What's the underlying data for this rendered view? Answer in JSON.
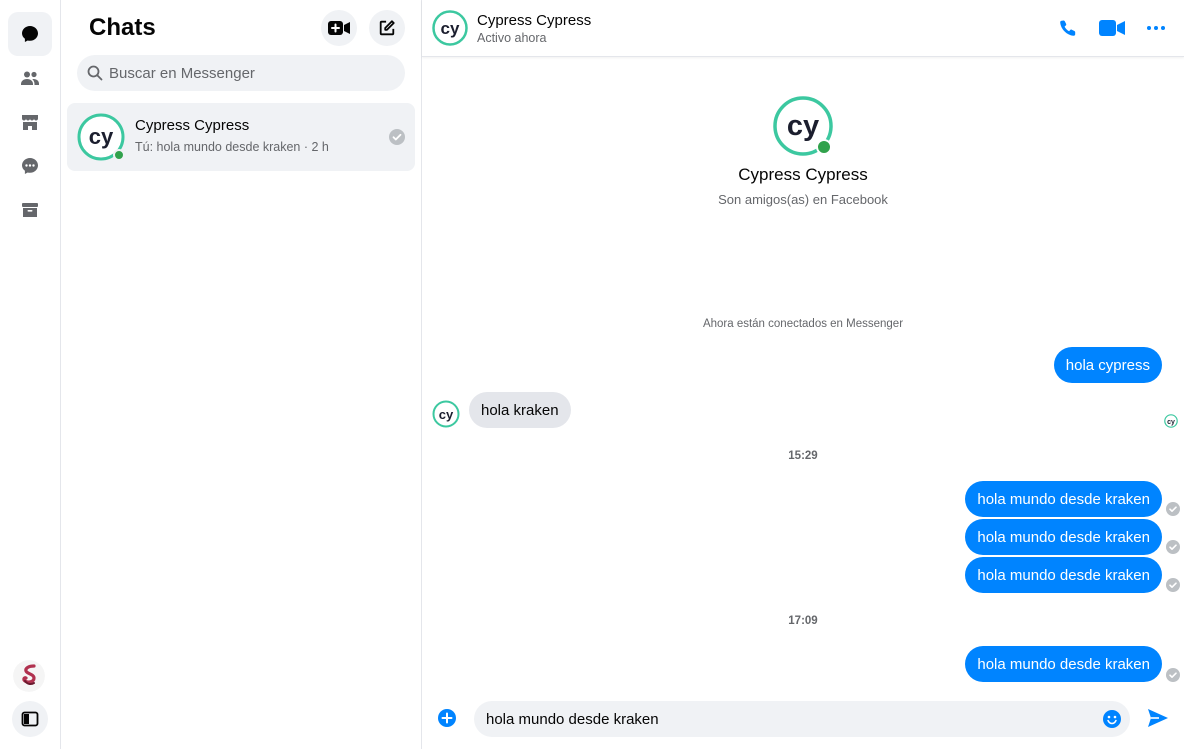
{
  "sidebar": {
    "chats_title": "Chats",
    "search_placeholder": "Buscar en Messenger",
    "conversations": [
      {
        "name": "Cypress Cypress",
        "preview": "Tú: hola mundo desde kraken",
        "time": "· 2 h",
        "online": true
      }
    ]
  },
  "header": {
    "name": "Cypress Cypress",
    "status": "Activo ahora"
  },
  "profile": {
    "name": "Cypress Cypress",
    "subtitle": "Son amigos(as) en Facebook"
  },
  "thread": {
    "system_message": "Ahora están conectados en Messenger",
    "timestamps": [
      "15:29",
      "17:09"
    ],
    "messages": [
      {
        "direction": "out",
        "text": "hola cypress"
      },
      {
        "direction": "in",
        "text": "hola kraken"
      },
      {
        "direction": "out",
        "text": "hola mundo desde kraken"
      },
      {
        "direction": "out",
        "text": "hola mundo desde kraken"
      },
      {
        "direction": "out",
        "text": "hola mundo desde kraken"
      },
      {
        "direction": "out",
        "text": "hola mundo desde kraken"
      }
    ]
  },
  "composer": {
    "value": "hola mundo desde kraken"
  },
  "colors": {
    "accent": "#0084ff",
    "online": "#31a24c",
    "cypress_green": "#3cc8a0",
    "cypress_dark": "#1b1e2e"
  },
  "icons": {
    "rail": [
      "chat-bubble-icon",
      "people-icon",
      "marketplace-icon",
      "message-requests-icon",
      "archive-icon"
    ],
    "header": [
      "phone-icon",
      "video-camera-icon",
      "more-options-icon"
    ]
  }
}
